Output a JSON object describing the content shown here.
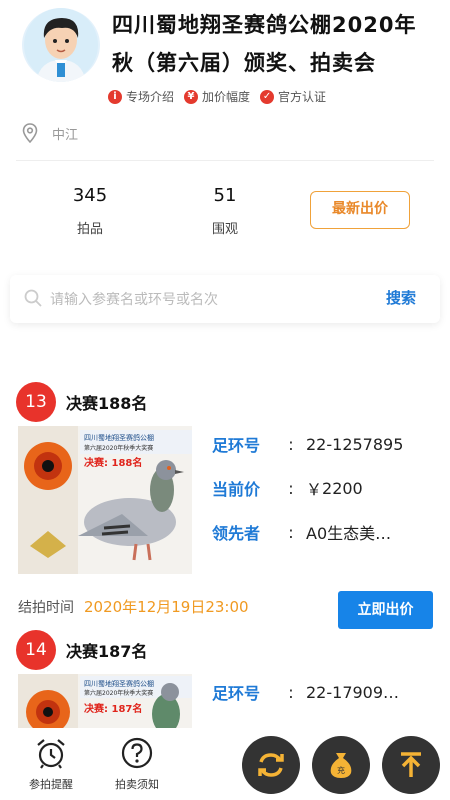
{
  "header": {
    "title": "四川蜀地翔圣赛鸽公棚2020年秋（第六届）颁奖、拍卖会",
    "badges": [
      {
        "icon": "info-icon",
        "label": "专场介绍"
      },
      {
        "icon": "yen-icon",
        "label": "加价幅度"
      },
      {
        "icon": "shield-check-icon",
        "label": "官方认证"
      }
    ]
  },
  "location": "中江",
  "stats": {
    "lots_count": "345",
    "lots_label": "拍品",
    "views_count": "51",
    "views_label": "围观",
    "latest_bid_label": "最新出价"
  },
  "search": {
    "placeholder": "请输入参赛名或环号或名次",
    "button": "搜索"
  },
  "lots": [
    {
      "number": "13",
      "name": "决赛188名",
      "image_rank": "决赛: 188名",
      "ring_label": "足环号",
      "ring_value": "22-1257895",
      "price_label": "当前价",
      "price_prefix": "￥",
      "price_value": "2200",
      "leader_label": "领先者",
      "leader_value": "A0生态美…"
    },
    {
      "number": "14",
      "name": "决赛187名",
      "image_rank": "决赛: 187名",
      "ring_label": "足环号",
      "ring_value": "22-17909…"
    }
  ],
  "end_time": {
    "label": "结拍时间",
    "value": "2020年12月19日23:00"
  },
  "bid_now_label": "立即出价",
  "bottom_nav": {
    "reminder_label": "参拍提醒",
    "guide_label": "拍卖须知"
  },
  "colors": {
    "accent_blue": "#1f7ad6",
    "accent_red": "#e8332b",
    "accent_orange": "#f09a22"
  }
}
